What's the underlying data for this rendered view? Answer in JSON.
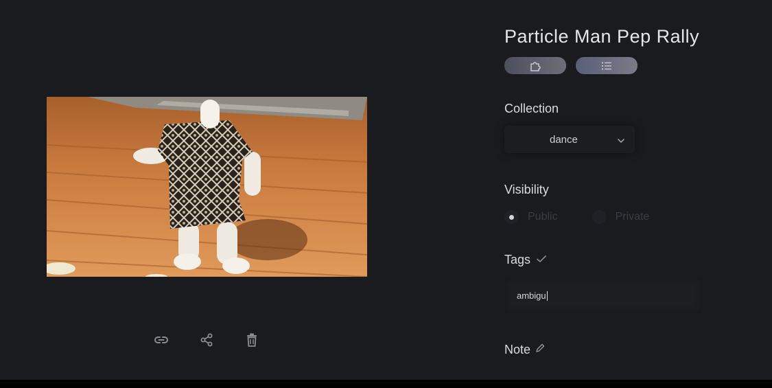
{
  "title": "Particle Man Pep Rally",
  "view_toggles": [
    {
      "name": "graph-view-toggle",
      "icon": "puzzle-icon"
    },
    {
      "name": "list-view-toggle",
      "icon": "list-icon"
    }
  ],
  "collection": {
    "label": "Collection",
    "selected": "dance",
    "icon": "chevron-down-icon"
  },
  "visibility": {
    "label": "Visibility",
    "options": [
      {
        "label": "Public",
        "checked": true
      },
      {
        "label": "Private",
        "checked": false
      }
    ]
  },
  "tags": {
    "label": "Tags",
    "icon": "check-icon",
    "value": "ambigu"
  },
  "note": {
    "label": "Note",
    "icon": "pencil-icon"
  },
  "media_actions": [
    {
      "name": "copy-link-button",
      "icon": "link-icon"
    },
    {
      "name": "share-button",
      "icon": "share-icon"
    },
    {
      "name": "delete-button",
      "icon": "trash-icon"
    }
  ],
  "colors": {
    "background": "#1a1b1e",
    "preview_floor": "#c9793c"
  }
}
